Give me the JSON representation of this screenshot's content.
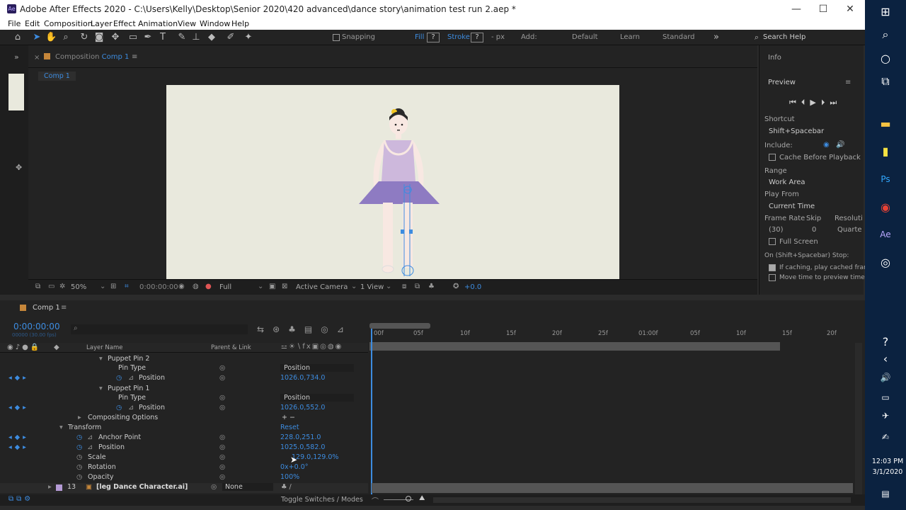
{
  "window": {
    "title": "Adobe After Effects 2020 - C:\\Users\\Kelly\\Desktop\\Senior 2020\\420 advanced\\dance story\\animation test run 2.aep *",
    "app_badge": "Ae",
    "minimize": "—",
    "maximize": "☐",
    "close": "✕"
  },
  "menu": [
    "File",
    "Edit",
    "Composition",
    "Layer",
    "Effect",
    "Animation",
    "View",
    "Window",
    "Help"
  ],
  "toolbar": {
    "snapping": "Snapping",
    "fill": "Fill",
    "stroke": "Stroke",
    "px": "- px",
    "add": "Add:",
    "workspaces": [
      "Default",
      "Learn",
      "Standard"
    ],
    "search": "Search Help"
  },
  "composition": {
    "tab_prefix": "Composition",
    "tab_name": "Comp 1",
    "sub_tab": "Comp 1",
    "zoom": "50%",
    "timecode": "0:00:00:00",
    "resolution": "Full",
    "camera": "Active Camera",
    "view": "1 View",
    "exposure": "+0.0"
  },
  "right_panel": {
    "info": "Info",
    "preview": "Preview",
    "shortcut_label": "Shortcut",
    "shortcut": "Shift+Spacebar",
    "include": "Include:",
    "cache_before_playback": "Cache Before Playback",
    "range_label": "Range",
    "range": "Work Area",
    "play_from_label": "Play From",
    "play_from": "Current Time",
    "frame_rate": "Frame Rate",
    "skip": "Skip",
    "resolution": "Resoluti",
    "frame_rate_value": "(30)",
    "skip_value": "0",
    "resolution_value": "Quarte",
    "full_screen": "Full Screen",
    "stop_label": "On (Shift+Spacebar) Stop:",
    "if_caching": "If caching, play cached frame",
    "move_time": "Move time to preview time"
  },
  "timeline": {
    "tab": "Comp 1",
    "timecode": "0:00:00:00",
    "fps": "00000 (30.00 fps)",
    "col_layer": "Layer Name",
    "col_parent": "Parent & Link",
    "ruler": [
      "00f",
      "05f",
      "10f",
      "15f",
      "20f",
      "25f",
      "01:00f",
      "05f",
      "10f",
      "15f",
      "20f"
    ],
    "rows": [
      {
        "label": "Puppet Pin 2",
        "value": ""
      },
      {
        "label": "Pin Type",
        "value": "Position"
      },
      {
        "label": "Position",
        "value": "1026.0,734.0"
      },
      {
        "label": "Puppet Pin 1",
        "value": ""
      },
      {
        "label": "Pin Type",
        "value": "Position"
      },
      {
        "label": "Position",
        "value": "1026.0,552.0"
      },
      {
        "label": "Compositing Options",
        "value": "+ −"
      },
      {
        "label": "Transform",
        "value": "Reset"
      },
      {
        "label": "Anchor Point",
        "value": "228.0,251.0"
      },
      {
        "label": "Position",
        "value": "1025.0,582.0"
      },
      {
        "label": "Scale",
        "value": "129.0,129.0%"
      },
      {
        "label": "Rotation",
        "value": "0x+0.0°"
      },
      {
        "label": "Opacity",
        "value": "100%"
      }
    ],
    "layer": {
      "num": "13",
      "name": "[leg Dance Character.ai]",
      "parent": "None"
    },
    "toggle": "Toggle Switches / Modes"
  },
  "clock": {
    "time": "12:03 PM",
    "date": "3/1/2020"
  }
}
